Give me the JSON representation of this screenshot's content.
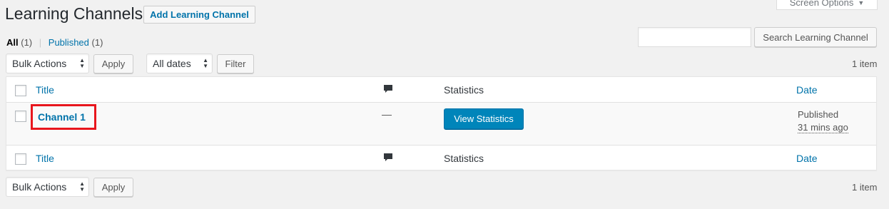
{
  "header": {
    "title": "Learning Channels",
    "add_new_label": "Add Learning Channel",
    "screen_options_label": "Screen Options"
  },
  "views": {
    "all_label": "All",
    "all_count": "(1)",
    "separator": "|",
    "published_label": "Published",
    "published_count": "(1)"
  },
  "search": {
    "input_value": "",
    "button_label": "Search Learning Channel"
  },
  "top_nav": {
    "bulk_actions": "Bulk Actions",
    "apply_label": "Apply",
    "dates_filter": "All dates",
    "filter_label": "Filter",
    "items_count": "1 item"
  },
  "table": {
    "columns": {
      "title": "Title",
      "statistics": "Statistics",
      "date": "Date"
    },
    "rows": [
      {
        "title": "Channel 1",
        "comments": "—",
        "statistics_button": "View Statistics",
        "date_status": "Published",
        "date_ago": "31 mins ago"
      }
    ]
  },
  "bottom_nav": {
    "bulk_actions": "Bulk Actions",
    "apply_label": "Apply",
    "items_count": "1 item"
  },
  "colors": {
    "link": "#0073aa",
    "primary_button": "#0085ba",
    "highlight_border": "#e8161d",
    "background": "#f1f1f1"
  },
  "icons": {
    "comment_column": "comment-bubble-icon",
    "select_arrows": "up-down-arrows-icon",
    "screen_options_arrow": "caret-down-icon"
  }
}
